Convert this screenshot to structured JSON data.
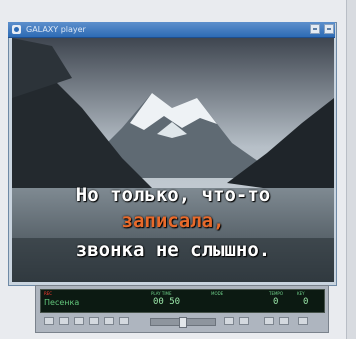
{
  "window": {
    "title": "GALAXY player",
    "buttons": [
      "minimize-icon",
      "close-icon"
    ]
  },
  "lyrics": {
    "line1": "Но только, что-то",
    "line2": "записала,",
    "line3": "звонка не слышно.",
    "colors": {
      "sung": "#ffffff",
      "current": "#e86a2b"
    }
  },
  "control_panel": {
    "labels": {
      "rec": "REC",
      "play_time": "PLAY TIME",
      "mode": "MODE",
      "tempo": "TEMPO",
      "key": "KEY"
    },
    "song": "Песенка",
    "time": "00 50",
    "tempo_value": "0",
    "key_value": "0"
  }
}
